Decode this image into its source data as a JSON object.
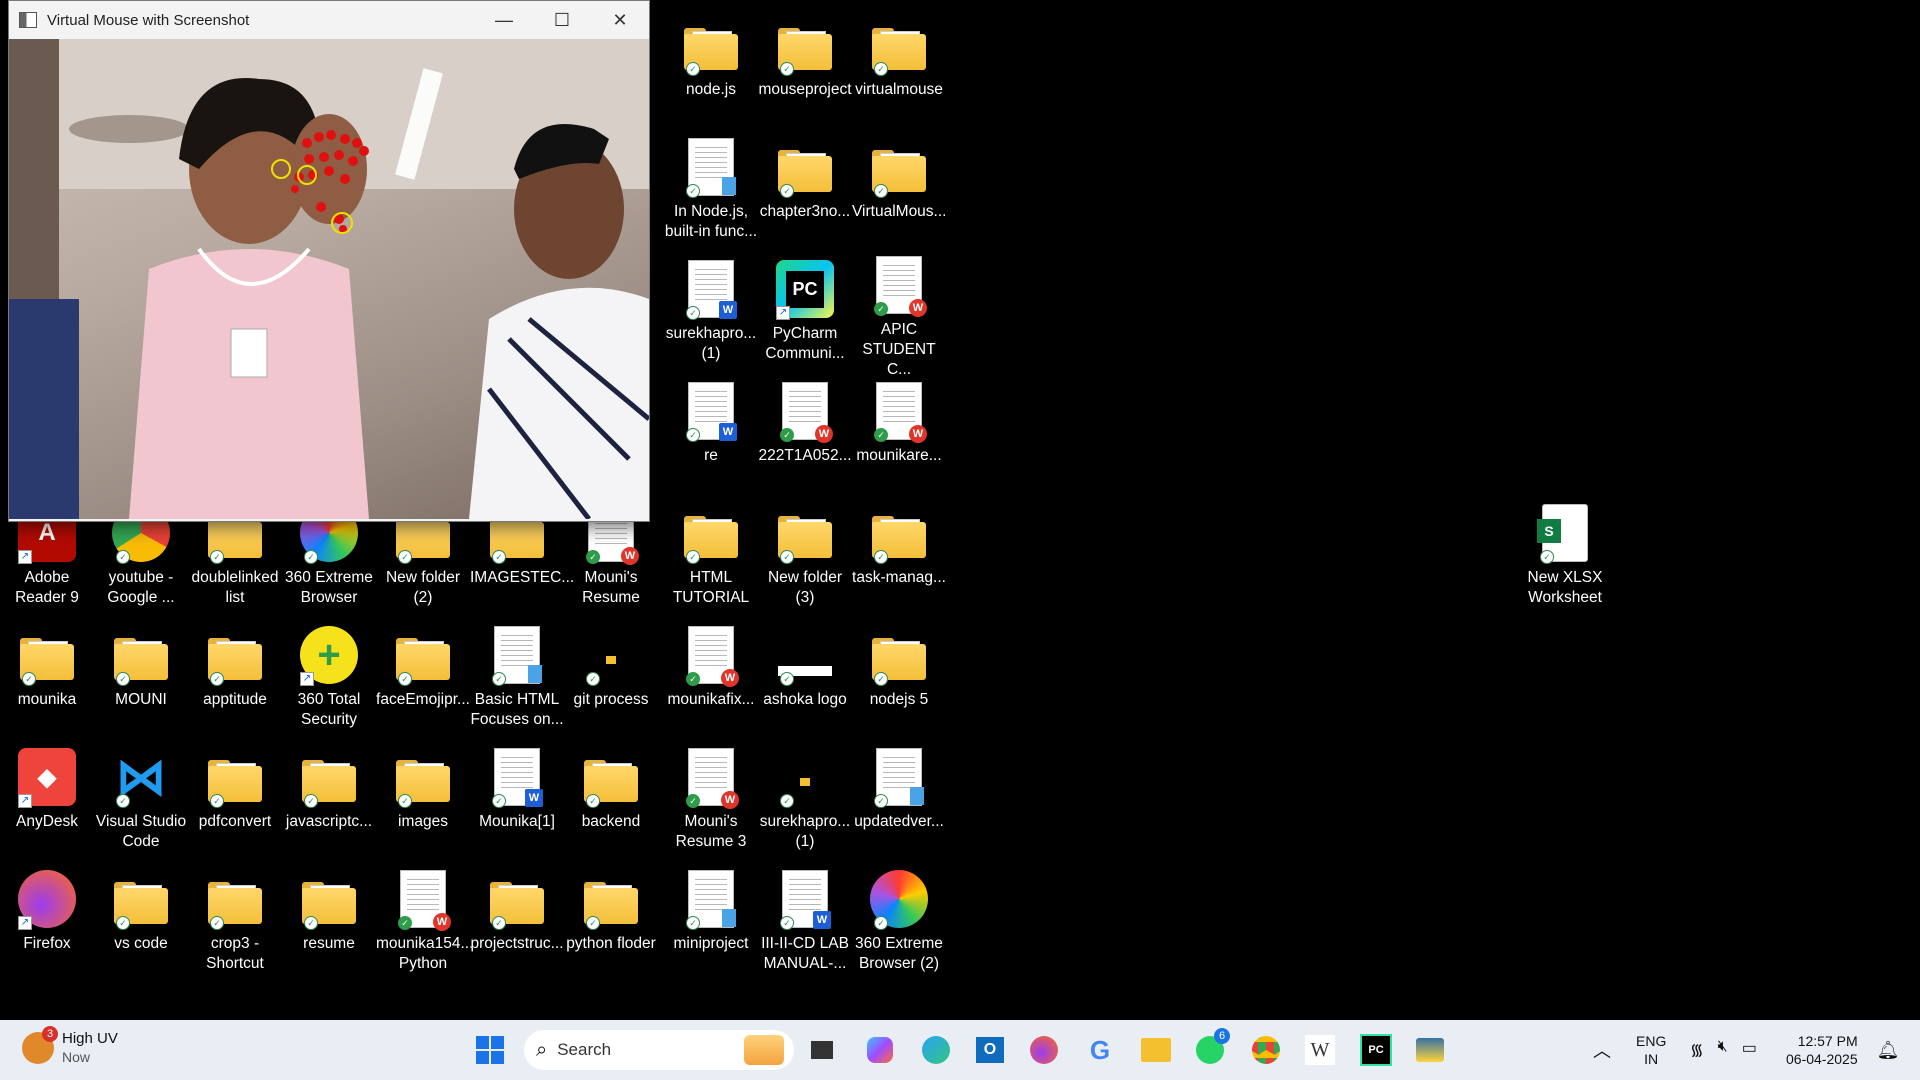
{
  "window": {
    "title": "Virtual Mouse with Screenshot",
    "minimize": "—",
    "maximize": "☐",
    "close": "✕"
  },
  "desktop_icons": [
    {
      "label": "node.js",
      "kind": "folder"
    },
    {
      "label": "mouseproject",
      "kind": "folder"
    },
    {
      "label": "virtualmouse",
      "kind": "folder"
    },
    {
      "label": "In Node.js,\nbuilt-in func...",
      "kind": "notepad"
    },
    {
      "label": "chapter3no...",
      "kind": "folder"
    },
    {
      "label": "VirtualMous...",
      "kind": "folder"
    },
    {
      "label": "surekhapro...\n(1)",
      "kind": "word"
    },
    {
      "label": "PyCharm\nCommuni...",
      "kind": "pycharm"
    },
    {
      "label": "APIC\nSTUDENT C...",
      "kind": "wps"
    },
    {
      "label": "re",
      "kind": "word"
    },
    {
      "label": "222T1A052...",
      "kind": "wps"
    },
    {
      "label": "mounikare...",
      "kind": "wps"
    },
    {
      "label": "Adobe\nReader 9",
      "kind": "adobe"
    },
    {
      "label": "youtube -\nGoogle ...",
      "kind": "chrome"
    },
    {
      "label": "doublelinked\nlist",
      "kind": "folder"
    },
    {
      "label": "360 Extreme\nBrowser",
      "kind": "360"
    },
    {
      "label": "New folder\n(2)",
      "kind": "folder"
    },
    {
      "label": "IMAGESTEC...",
      "kind": "folder"
    },
    {
      "label": "Mouni's\nResume",
      "kind": "wps"
    },
    {
      "label": "HTML\nTUTORIAL",
      "kind": "folder"
    },
    {
      "label": "New folder\n(3)",
      "kind": "folder"
    },
    {
      "label": "task-manag...",
      "kind": "folder"
    },
    {
      "label": "mounika",
      "kind": "folder"
    },
    {
      "label": "MOUNI",
      "kind": "folder"
    },
    {
      "label": "apptitude",
      "kind": "folder"
    },
    {
      "label": "360 Total\nSecurity",
      "kind": "360total"
    },
    {
      "label": "faceEmojipr...",
      "kind": "folder"
    },
    {
      "label": "Basic HTML\nFocuses on...",
      "kind": "notepad"
    },
    {
      "label": "git process",
      "kind": "small"
    },
    {
      "label": "mounikafix...",
      "kind": "wps"
    },
    {
      "label": "ashoka logo",
      "kind": "image"
    },
    {
      "label": "nodejs 5",
      "kind": "folder"
    },
    {
      "label": "AnyDesk",
      "kind": "anydesk"
    },
    {
      "label": "Visual Studio\nCode",
      "kind": "vscode"
    },
    {
      "label": "pdfconvert",
      "kind": "folder"
    },
    {
      "label": "javascriptc...",
      "kind": "folder"
    },
    {
      "label": "images",
      "kind": "folder"
    },
    {
      "label": "Mounika[1]",
      "kind": "word"
    },
    {
      "label": "backend",
      "kind": "folder"
    },
    {
      "label": "Mouni's\nResume 3",
      "kind": "wps"
    },
    {
      "label": "surekhapro...\n(1)",
      "kind": "small"
    },
    {
      "label": "updatedver...",
      "kind": "notepad"
    },
    {
      "label": "Firefox",
      "kind": "firefox"
    },
    {
      "label": "vs code",
      "kind": "folder"
    },
    {
      "label": "crop3 -\nShortcut",
      "kind": "folder"
    },
    {
      "label": "resume",
      "kind": "folder"
    },
    {
      "label": "mounika154...\nPython",
      "kind": "wps"
    },
    {
      "label": "projectstruc...",
      "kind": "folder"
    },
    {
      "label": "python floder",
      "kind": "folder"
    },
    {
      "label": "miniproject",
      "kind": "notepad"
    },
    {
      "label": "III-II-CD LAB\nMANUAL-...",
      "kind": "word"
    },
    {
      "label": "360 Extreme\nBrowser (2)",
      "kind": "360"
    },
    {
      "label": "New XLSX\nWorksheet",
      "kind": "sheets"
    }
  ],
  "taskbar": {
    "weather": {
      "badge": "3",
      "title": "High UV",
      "subtitle": "Now"
    },
    "search_placeholder": "Search",
    "apps": [
      "windows-start",
      "search",
      "task-view",
      "copilot",
      "edge",
      "outlook",
      "firefox",
      "google",
      "file-explorer",
      "whatsapp",
      "chrome",
      "wikipedia",
      "pycharm",
      "python"
    ],
    "whatsapp_badge": "6",
    "lang_top": "ENG",
    "lang_bottom": "IN",
    "time": "12:57 PM",
    "date": "06-04-2025"
  }
}
